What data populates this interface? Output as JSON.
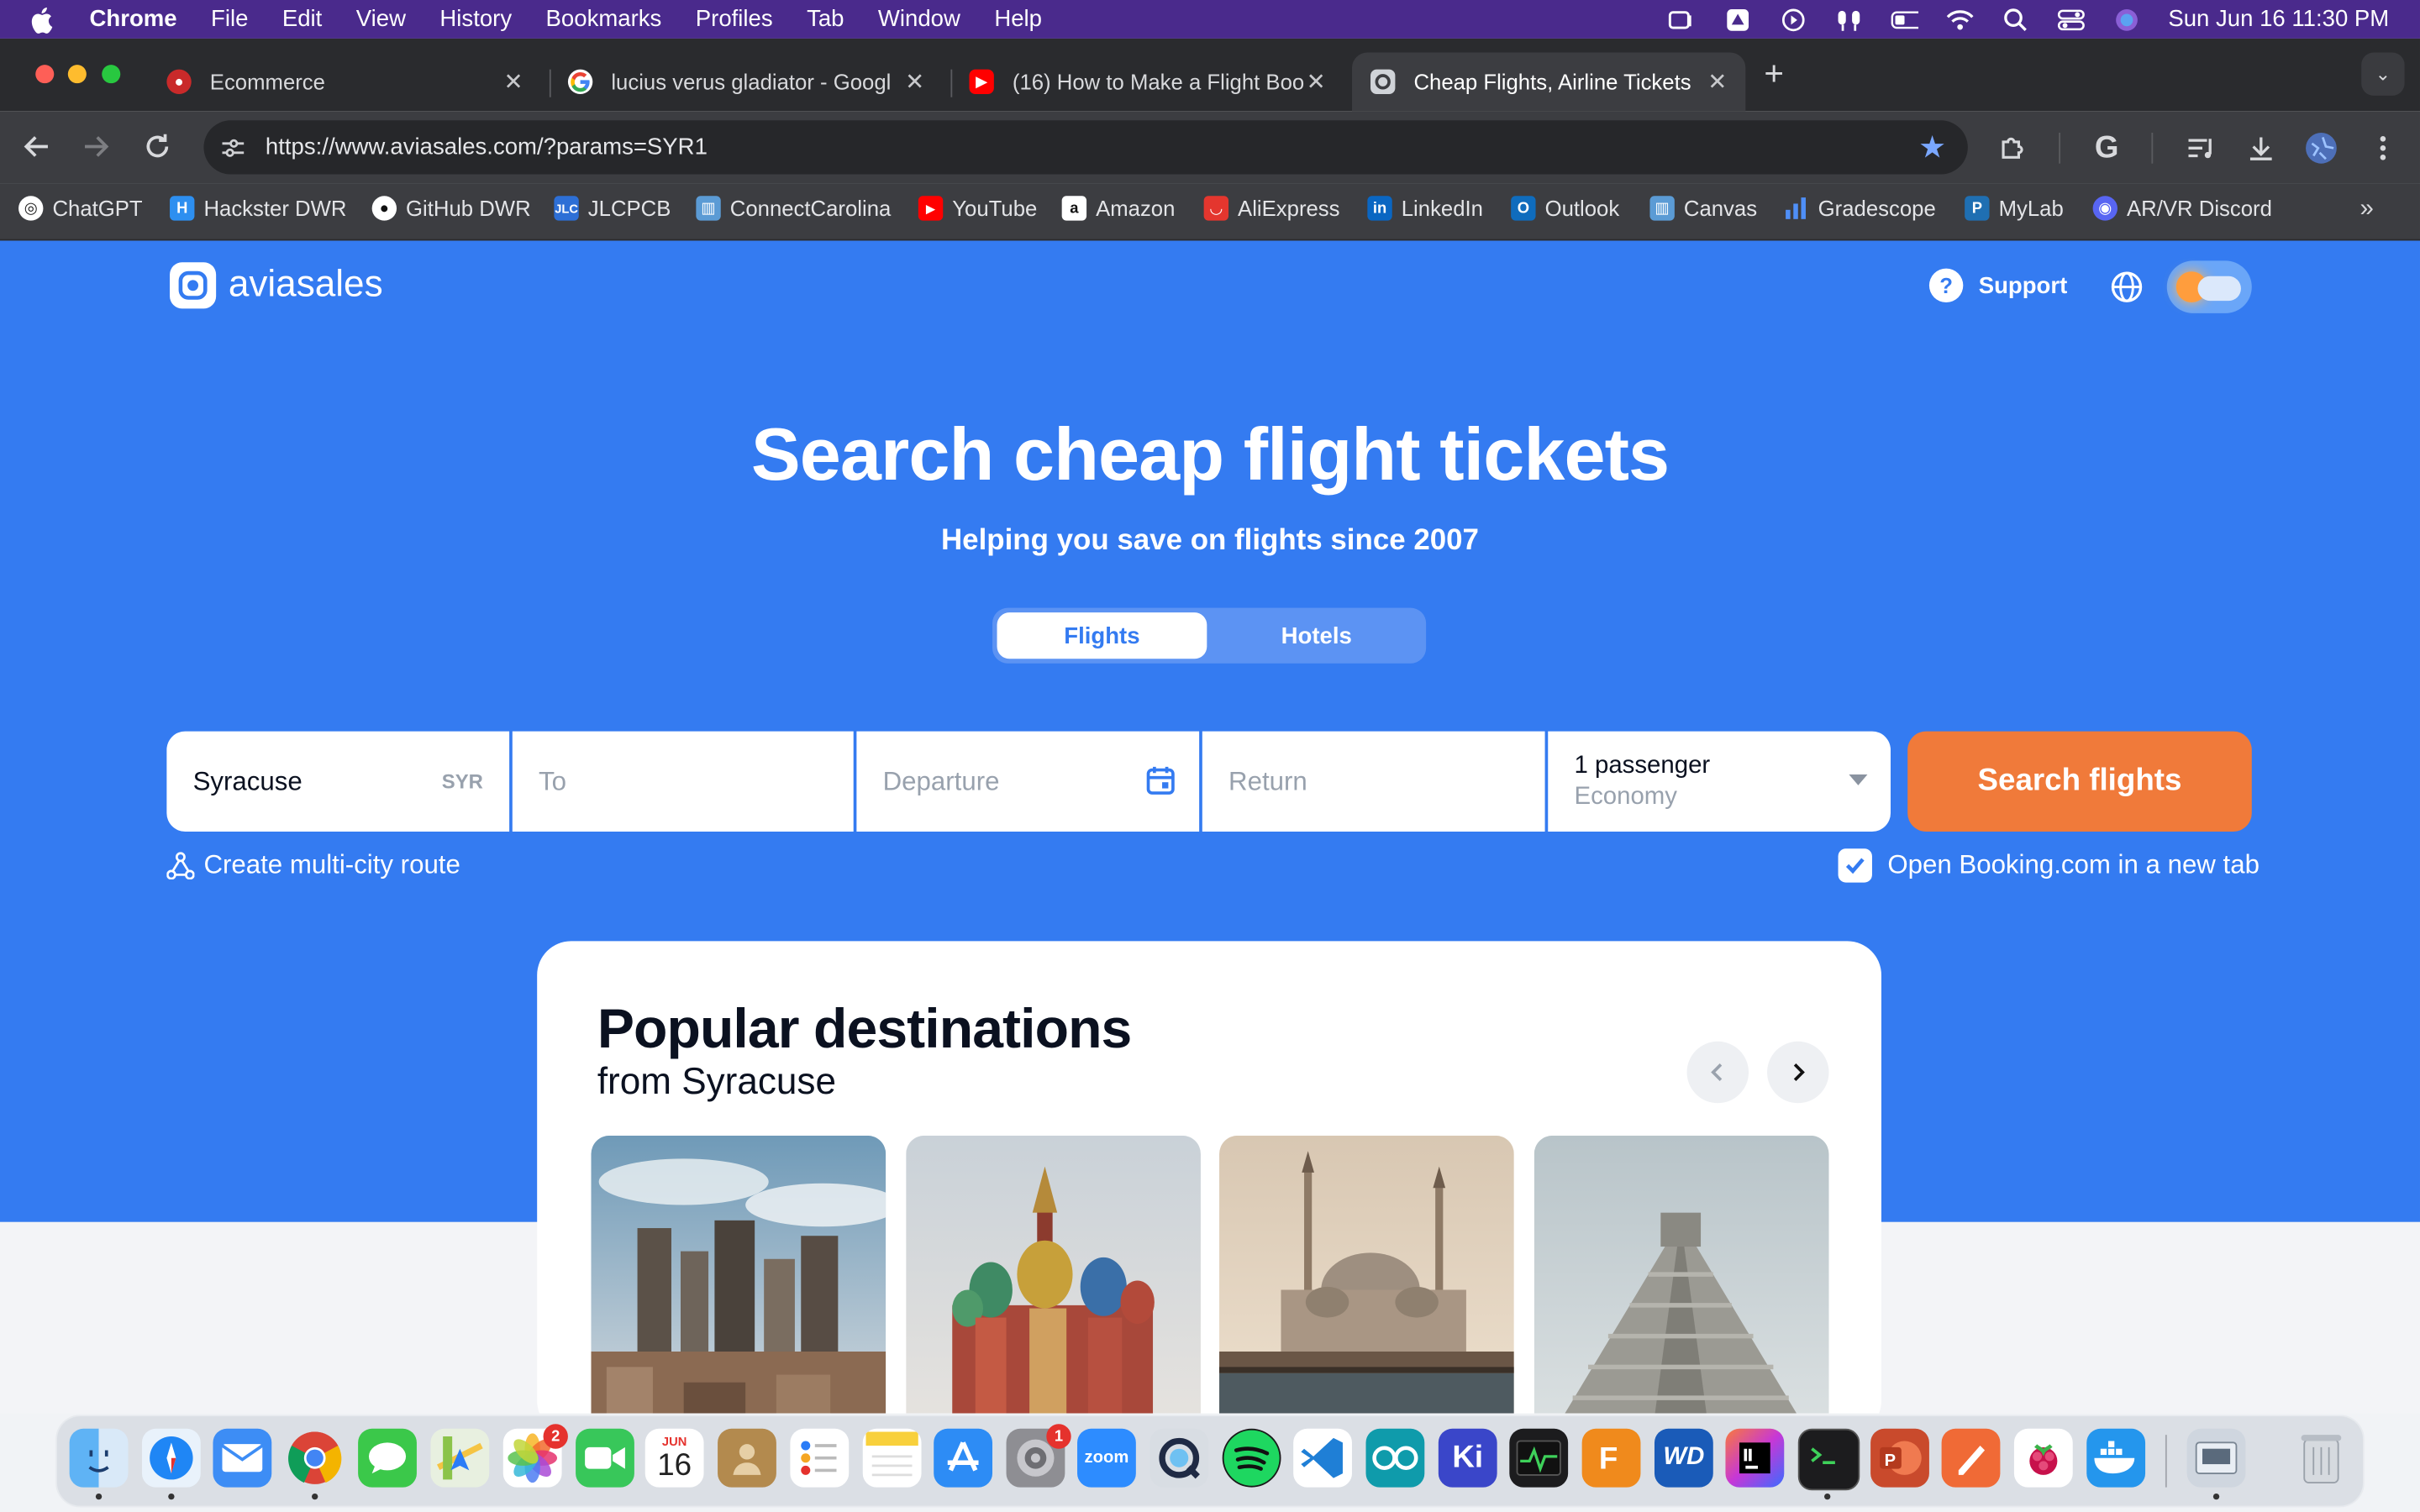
{
  "menubar": {
    "app": "Chrome",
    "items": [
      "File",
      "Edit",
      "View",
      "History",
      "Bookmarks",
      "Profiles",
      "Tab",
      "Window",
      "Help"
    ],
    "clock": "Sun Jun 16  11:30 PM"
  },
  "tabs": [
    {
      "title": "Ecommerce",
      "icon": "ecommerce-icon"
    },
    {
      "title": "lucius verus gladiator - Googl",
      "icon": "google-icon"
    },
    {
      "title": "(16) How to Make a Flight Boo",
      "icon": "youtube-icon"
    },
    {
      "title": "Cheap Flights, Airline Tickets",
      "icon": "aviasales-icon"
    }
  ],
  "toolbar": {
    "url": "https://www.aviasales.com/?params=SYR1"
  },
  "bookmarks": [
    "ChatGPT",
    "Hackster DWR",
    "GitHub DWR",
    "JLCPCB",
    "ConnectCarolina",
    "YouTube",
    "Amazon",
    "AliExpress",
    "LinkedIn",
    "Outlook",
    "Canvas",
    "Gradescope",
    "MyLab",
    "AR/VR Discord"
  ],
  "site": {
    "logo": "aviasales",
    "support": "Support",
    "headline": "Search cheap flight tickets",
    "subline": "Helping you save on flights since 2007",
    "tabs": {
      "flights": "Flights",
      "hotels": "Hotels"
    },
    "form": {
      "origin_value": "Syracuse",
      "origin_code": "SYR",
      "to_placeholder": "To",
      "departure_placeholder": "Departure",
      "return_placeholder": "Return",
      "passengers": "1 passenger",
      "cabin": "Economy",
      "search_button": "Search flights"
    },
    "multicity": "Create multi-city route",
    "booking_checkbox": "Open Booking.com in a new tab",
    "booking_checked": true,
    "popular": {
      "title": "Popular destinations",
      "subtitle": "from Syracuse"
    },
    "colors": {
      "brand": "#347bf1",
      "accent": "#f07a3a"
    }
  },
  "dock": {
    "calendar_month": "JUN",
    "calendar_day": "16",
    "photos_badge": "2",
    "settings_badge": "1",
    "zoom_label": "zoom",
    "kicad_label": "Ki",
    "wd_label": "WD"
  }
}
